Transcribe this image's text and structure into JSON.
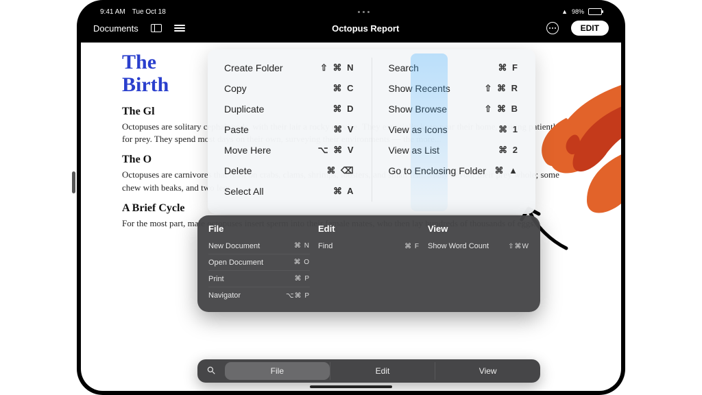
{
  "status": {
    "time": "9:41 AM",
    "date": "Tue Oct 18"
  },
  "toolbar": {
    "back_label": "Documents",
    "title": "Octopus Report",
    "edit_label": "EDIT"
  },
  "document": {
    "title_line1": "The",
    "title_line2": "Birth",
    "sec1_title": "The Gl",
    "sec1_body": "Octopuses are solitary cephalopods, with their lair a rocky crevice. They especially keep near their home, waiting patiently for prey. They spend most days on their own, surveying their environments — the more...",
    "sec2_title": "The O",
    "sec2_body": "Octopuses are carnivores that feast on crabs, clams, shrimps, lobsters, and small fish. Many devour their prey whole; some chew with beaks, and two legs...",
    "sec3_title": "A Brief Cycle",
    "sec3_body": "For the most part, male octopuses insert sperm into their female mates, who then lay hundreds of thousands of eggs."
  },
  "light_panel": {
    "col1": [
      {
        "label": "Create Folder",
        "shortcut": "⇧ ⌘ N"
      },
      {
        "label": "Copy",
        "shortcut": "⌘ C"
      },
      {
        "label": "Duplicate",
        "shortcut": "⌘ D"
      },
      {
        "label": "Paste",
        "shortcut": "⌘ V"
      },
      {
        "label": "Move Here",
        "shortcut": "⌥ ⌘ V"
      },
      {
        "label": "Delete",
        "shortcut": "⌘ ⌫"
      },
      {
        "label": "Select All",
        "shortcut": "⌘ A"
      }
    ],
    "col2": [
      {
        "label": "Search",
        "shortcut": "⌘ F"
      },
      {
        "label": "Show Recents",
        "shortcut": "⇧ ⌘ R"
      },
      {
        "label": "Show Browse",
        "shortcut": "⇧ ⌘ B"
      },
      {
        "label": "View as Icons",
        "shortcut": "⌘ 1"
      },
      {
        "label": "View as List",
        "shortcut": "⌘ 2"
      },
      {
        "label": "Go to Enclosing Folder",
        "shortcut": "⌘ ▲"
      }
    ]
  },
  "dark_panel": {
    "cols": [
      {
        "title": "File",
        "rows": [
          {
            "label": "New Document",
            "shortcut": "⌘ N"
          },
          {
            "label": "Open Document",
            "shortcut": "⌘ O"
          },
          {
            "label": "Print",
            "shortcut": "⌘ P"
          },
          {
            "label": "Navigator",
            "shortcut": "⌥⌘ P"
          }
        ]
      },
      {
        "title": "Edit",
        "rows": [
          {
            "label": "Find",
            "shortcut": "⌘ F"
          }
        ]
      },
      {
        "title": "View",
        "rows": [
          {
            "label": "Show Word Count",
            "shortcut": "⇧⌘W"
          }
        ]
      }
    ]
  },
  "cmd_bar": {
    "tabs": [
      "File",
      "Edit",
      "View"
    ],
    "active": 0
  }
}
